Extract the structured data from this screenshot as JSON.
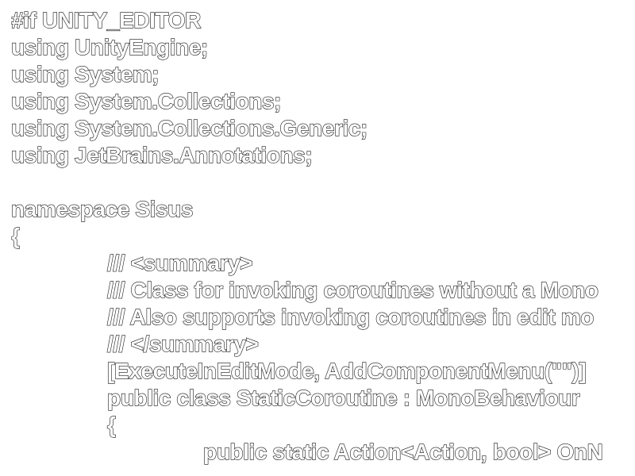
{
  "editor": {
    "lines": [
      "#if UNITY_EDITOR",
      "using UnityEngine;",
      "using System;",
      "using System.Collections;",
      "using System.Collections.Generic;",
      "using JetBrains.Annotations;",
      "",
      "namespace Sisus",
      "{",
      "/// <summary>",
      "/// Class for invoking coroutines without a Mono",
      "/// Also supports invoking coroutines in edit mo",
      "/// </summary>",
      "[ExecuteInEditMode, AddComponentMenu(\"\")]",
      "public class StaticCoroutine : MonoBehaviour",
      "{",
      "public static Action<Action, bool> OnN"
    ]
  }
}
